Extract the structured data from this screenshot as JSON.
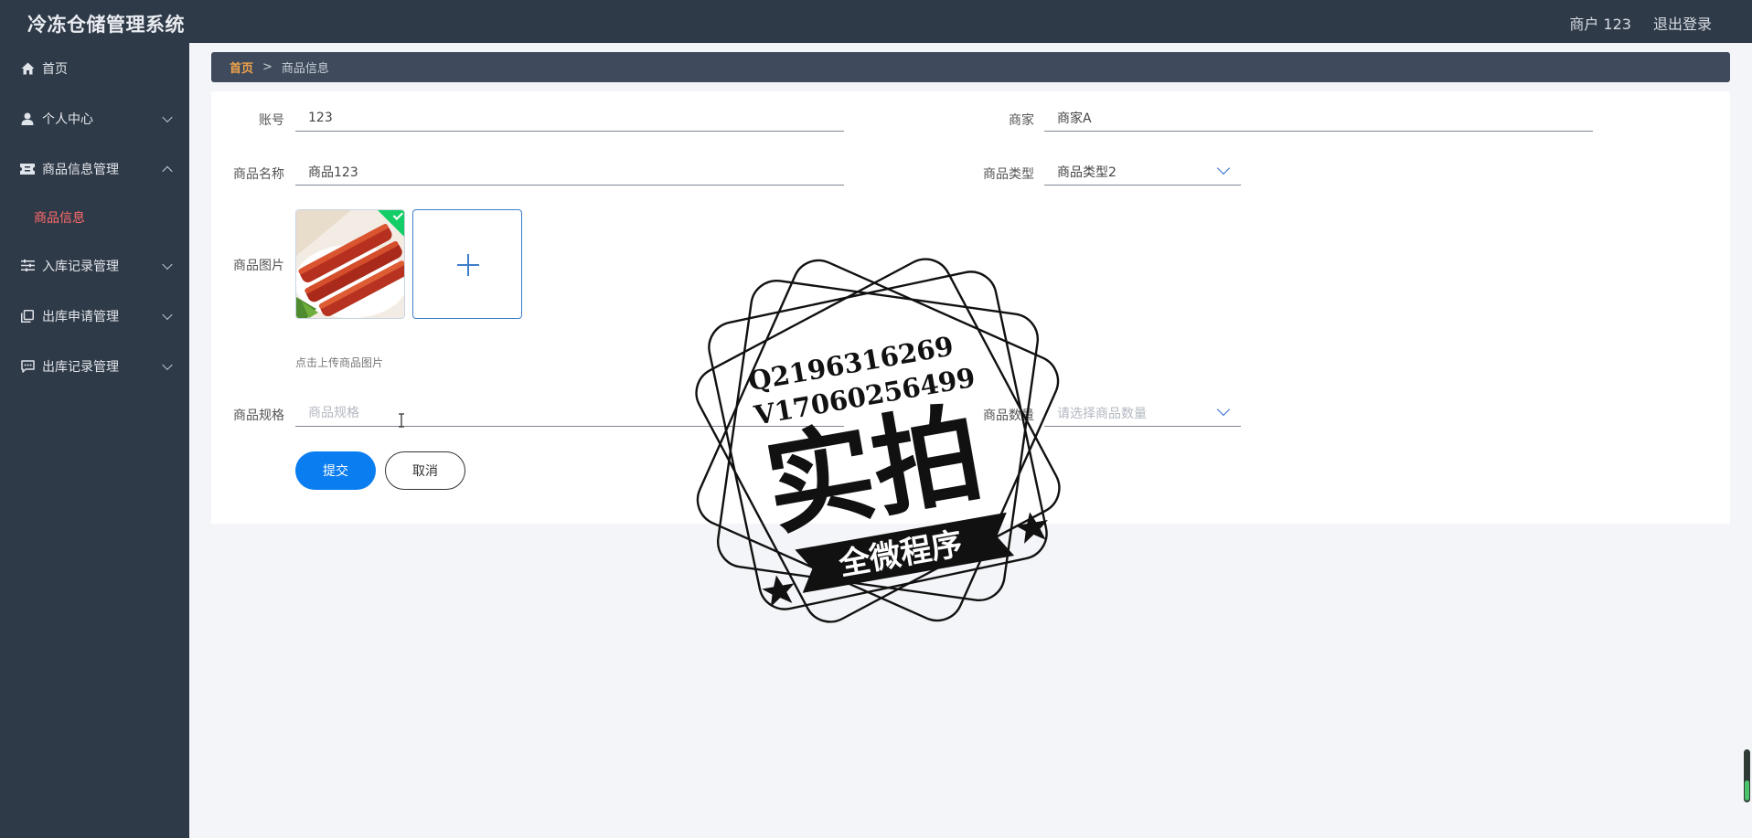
{
  "app": {
    "title": "冷冻仓储管理系统",
    "user_label": "商户 123",
    "logout_label": "退出登录"
  },
  "sidebar": {
    "items": [
      {
        "label": "首页",
        "icon": "home-icon"
      },
      {
        "label": "个人中心",
        "icon": "user-icon"
      },
      {
        "label": "商品信息管理",
        "icon": "ticket-icon",
        "expanded": true
      },
      {
        "label": "入库记录管理",
        "icon": "sliders-icon"
      },
      {
        "label": "出库申请管理",
        "icon": "copy-icon"
      },
      {
        "label": "出库记录管理",
        "icon": "chat-icon"
      }
    ],
    "submenu": {
      "label": "商品信息",
      "color": "#ff6b6b"
    }
  },
  "breadcrumb": {
    "home": "首页",
    "separator": ">",
    "current": "商品信息"
  },
  "form": {
    "account": {
      "label": "账号",
      "value": "123"
    },
    "merchant": {
      "label": "商家",
      "value": "商家A"
    },
    "product_name": {
      "label": "商品名称",
      "value": "商品123"
    },
    "product_type": {
      "label": "商品类型",
      "value": "商品类型2"
    },
    "product_image": {
      "label": "商品图片",
      "hint": "点击上传商品图片"
    },
    "spec": {
      "label": "商品规格",
      "placeholder": "商品规格"
    },
    "quantity": {
      "label": "商品数量",
      "placeholder": "请选择商品数量"
    },
    "submit_label": "提交",
    "cancel_label": "取消"
  },
  "watermark": {
    "line1": "Q2196316269",
    "line2": "V17060256499",
    "main": "实拍",
    "banner": "全微程序"
  },
  "colors": {
    "nav_bg": "#2f3a48",
    "primary": "#0a7df0",
    "breadcrumb_home": "#f0a24a"
  }
}
